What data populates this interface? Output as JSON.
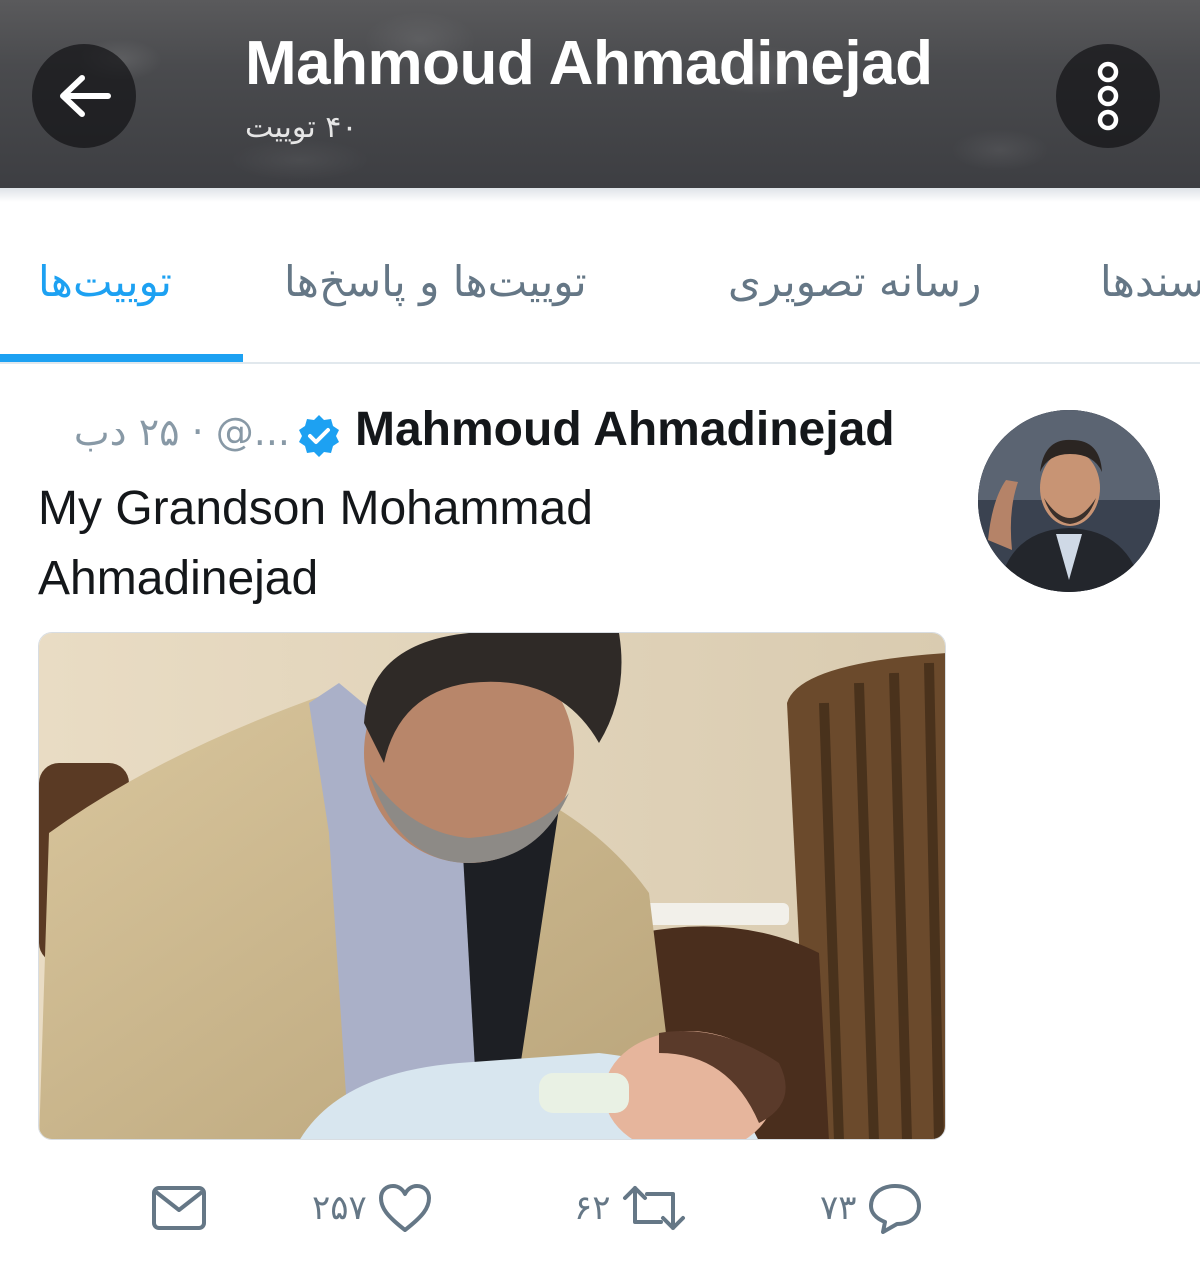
{
  "header": {
    "title": "Mahmoud Ahmadinejad",
    "tweet_count": "۴۰ توییت"
  },
  "tabs": [
    {
      "label": "توییت‌ها",
      "active": true
    },
    {
      "label": "توییت‌ها و پاسخ‌ها",
      "active": false
    },
    {
      "label": "رسانه تصویری",
      "active": false
    },
    {
      "label": "سندها",
      "active": false
    }
  ],
  "tweet": {
    "author": "Mahmoud Ahmadinejad",
    "meta": "...@ · ۲۵ دب",
    "text_line1": "My Grandson Mohammad",
    "text_line2": "Ahmadinejad",
    "reply_count": "۷۳",
    "retweet_count": "۶۲",
    "like_count": "۲۵۷"
  },
  "colors": {
    "accent": "#1da1f2",
    "secondary_text": "#657786"
  },
  "icons": [
    "back-arrow-icon",
    "more-vertical-icon",
    "verified-badge-icon",
    "reply-icon",
    "retweet-icon",
    "like-icon",
    "direct-message-icon"
  ]
}
